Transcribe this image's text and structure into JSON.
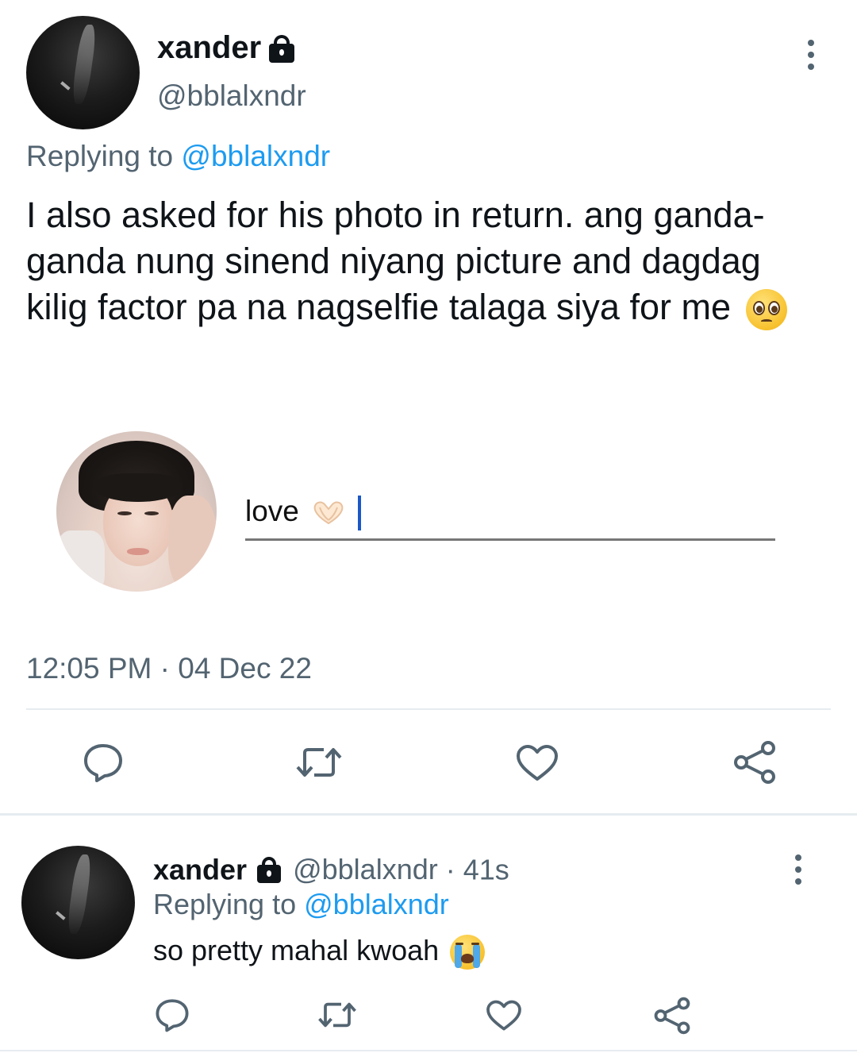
{
  "main_tweet": {
    "display_name": "xander",
    "handle": "@bblalxndr",
    "replying_prefix": "Replying to",
    "replying_handle": "@bblalxndr",
    "text": "I also asked for his photo in return. ang ganda-ganda nung sinend niyang picture and dagdag kilig factor pa na nagselfie talaga siya for me",
    "text_emoji": "🥺",
    "attachment": {
      "caption_text": "love",
      "caption_emoji": "🫶"
    },
    "timestamp": "12:05 PM · 04 Dec 22",
    "actions": [
      "reply-icon",
      "retweet-icon",
      "like-icon",
      "share-icon"
    ]
  },
  "reply_tweet": {
    "display_name": "xander",
    "handle": "@bblalxndr",
    "time_ago": "· 41s",
    "replying_prefix": "Replying to",
    "replying_handle": "@bblalxndr",
    "text": "so pretty mahal kwoah",
    "text_emoji": "😭",
    "actions": [
      "reply-icon",
      "retweet-icon",
      "like-icon",
      "share-icon"
    ]
  },
  "colors": {
    "link": "#1d9bf0",
    "secondary_text": "#536471",
    "primary_text": "#0f1419",
    "divider": "#e6ecf0"
  }
}
